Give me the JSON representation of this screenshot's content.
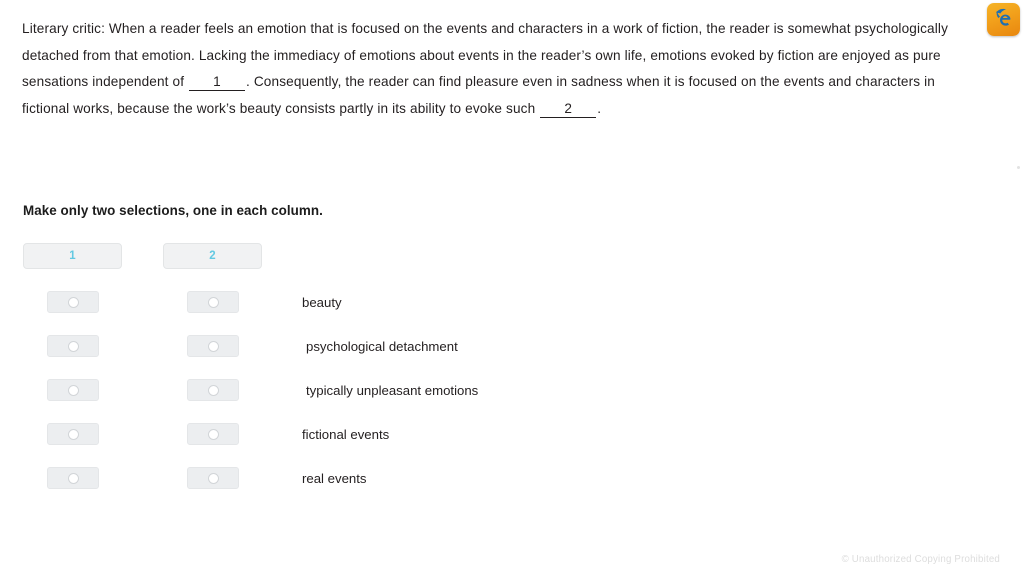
{
  "brand": {
    "icon_name": "e-logo-icon",
    "bg_color": "#f2a01b",
    "mark_color": "#1f6fb2"
  },
  "passage": {
    "segment_1": "Literary critic: When a reader feels an emotion that is focused on the events and characters in a work of fiction, the reader is somewhat psychologically detached from that emotion. Lacking the immediacy of emotions about events in the reader’s own life, emotions evoked by fiction are enjoyed as pure sensations independent of ",
    "blank_1": "1",
    "segment_2": ". Consequently, the reader can find pleasure even in sadness when it is focused on the events and characters in fictional works, because the work’s beauty consists partly in its ability to evoke such ",
    "blank_2": "2",
    "segment_3": "."
  },
  "instruction": "Make only two selections, one in each column.",
  "answer_grid": {
    "column_headers": [
      "1",
      "2"
    ],
    "header_color": "#63c9e2",
    "options": [
      {
        "label": "beauty",
        "indented": false,
        "col1_selected": false,
        "col2_selected": false
      },
      {
        "label": "psychological detachment",
        "indented": true,
        "col1_selected": false,
        "col2_selected": false
      },
      {
        "label": "typically unpleasant emotions",
        "indented": true,
        "col1_selected": false,
        "col2_selected": false
      },
      {
        "label": "fictional events",
        "indented": false,
        "col1_selected": false,
        "col2_selected": false
      },
      {
        "label": "real events",
        "indented": false,
        "col1_selected": false,
        "col2_selected": false
      }
    ]
  },
  "footer": {
    "copyright": "© Unauthorized Copying Prohibited"
  }
}
